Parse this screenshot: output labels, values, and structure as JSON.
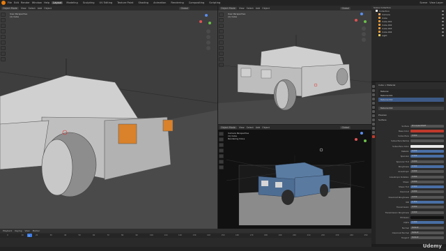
{
  "topbar": {
    "menus": [
      "File",
      "Edit",
      "Render",
      "Window",
      "Help"
    ],
    "tabs": [
      "Layout",
      "Modeling",
      "Sculpting",
      "UV Editing",
      "Texture Paint",
      "Shading",
      "Animation",
      "Rendering",
      "Compositing",
      "Scripting"
    ],
    "active_tab": "Layout",
    "scene_label": "Scene",
    "view_layer_label": "View Layer"
  },
  "viewport_left": {
    "mode": "Object Mode",
    "menus": [
      "View",
      "Select",
      "Add",
      "Object"
    ],
    "info_line1": "User Perspective",
    "info_line2": "(1) Cube",
    "shading": "Global"
  },
  "viewport_top_right": {
    "mode": "Object Mode",
    "menus": [
      "View",
      "Select",
      "Add",
      "Object"
    ],
    "info_line1": "User Perspective",
    "info_line2": "(1) Cube",
    "shading": "Global"
  },
  "viewport_bottom_right": {
    "mode": "Object Mode",
    "menus": [
      "View",
      "Select",
      "Add",
      "Object"
    ],
    "info_line1": "Camera Perspective",
    "info_line2": "(1) Cube",
    "info_line3": "Rendering Done",
    "shading": "Global"
  },
  "outliner": {
    "header": "Scene Collection",
    "items": [
      "Collection",
      "Camera",
      "Cube",
      "Cube.001",
      "Cube.002",
      "Cube.003",
      "Cube.004",
      "Light"
    ]
  },
  "properties": {
    "object_name": "Cube",
    "tabs_header": "Cube > Material",
    "material_slots": [
      "Material",
      "Material.001",
      "Material.002"
    ],
    "material_name": "Material.002",
    "sections": [
      "Preview",
      "Surface"
    ],
    "surface_type": "Principled BSDF",
    "fields": [
      {
        "label": "Surface",
        "value": "Principled BSDF"
      },
      {
        "label": "Base Color",
        "value": ""
      },
      {
        "label": "Subsurface",
        "value": "0.000"
      },
      {
        "label": "Subsurface Radius",
        "value": ""
      },
      {
        "label": "Subsurface Color",
        "value": ""
      },
      {
        "label": "Metallic",
        "value": "0.000"
      },
      {
        "label": "Specular",
        "value": "0.500"
      },
      {
        "label": "Specular Tint",
        "value": "0.000"
      },
      {
        "label": "Roughness",
        "value": "0.500"
      },
      {
        "label": "Anisotropic",
        "value": "0.000"
      },
      {
        "label": "Anisotropic Rotation",
        "value": "0.000"
      },
      {
        "label": "Sheen",
        "value": "0.000"
      },
      {
        "label": "Sheen Tint",
        "value": "0.500"
      },
      {
        "label": "Clearcoat",
        "value": "0.000"
      },
      {
        "label": "Clearcoat Roughness",
        "value": "0.030"
      },
      {
        "label": "IOR",
        "value": "1.450"
      },
      {
        "label": "Transmission",
        "value": "0.000"
      },
      {
        "label": "Transmission Roughness",
        "value": "0.000"
      },
      {
        "label": "Emission",
        "value": ""
      },
      {
        "label": "Alpha",
        "value": "1.000"
      },
      {
        "label": "Normal",
        "value": "Default"
      },
      {
        "label": "Clearcoat Normal",
        "value": "Default"
      },
      {
        "label": "Tangent",
        "value": "Default"
      }
    ]
  },
  "timeline": {
    "menus": [
      "Playback",
      "Keying",
      "View",
      "Marker"
    ],
    "current_frame": "1",
    "ticks": [
      "0",
      "10",
      "20",
      "30",
      "40",
      "50",
      "60",
      "70",
      "80",
      "90",
      "100",
      "110",
      "120",
      "130",
      "140",
      "150",
      "160",
      "170",
      "180",
      "190",
      "200",
      "210",
      "220",
      "230",
      "240",
      "250"
    ]
  },
  "watermark": "Udemy",
  "colors": {
    "accent_orange": "#e87d0d",
    "selection_blue": "#3f7ee8",
    "base_color_red": "#c0392b",
    "car_body_grey": "#b8b8b8"
  }
}
